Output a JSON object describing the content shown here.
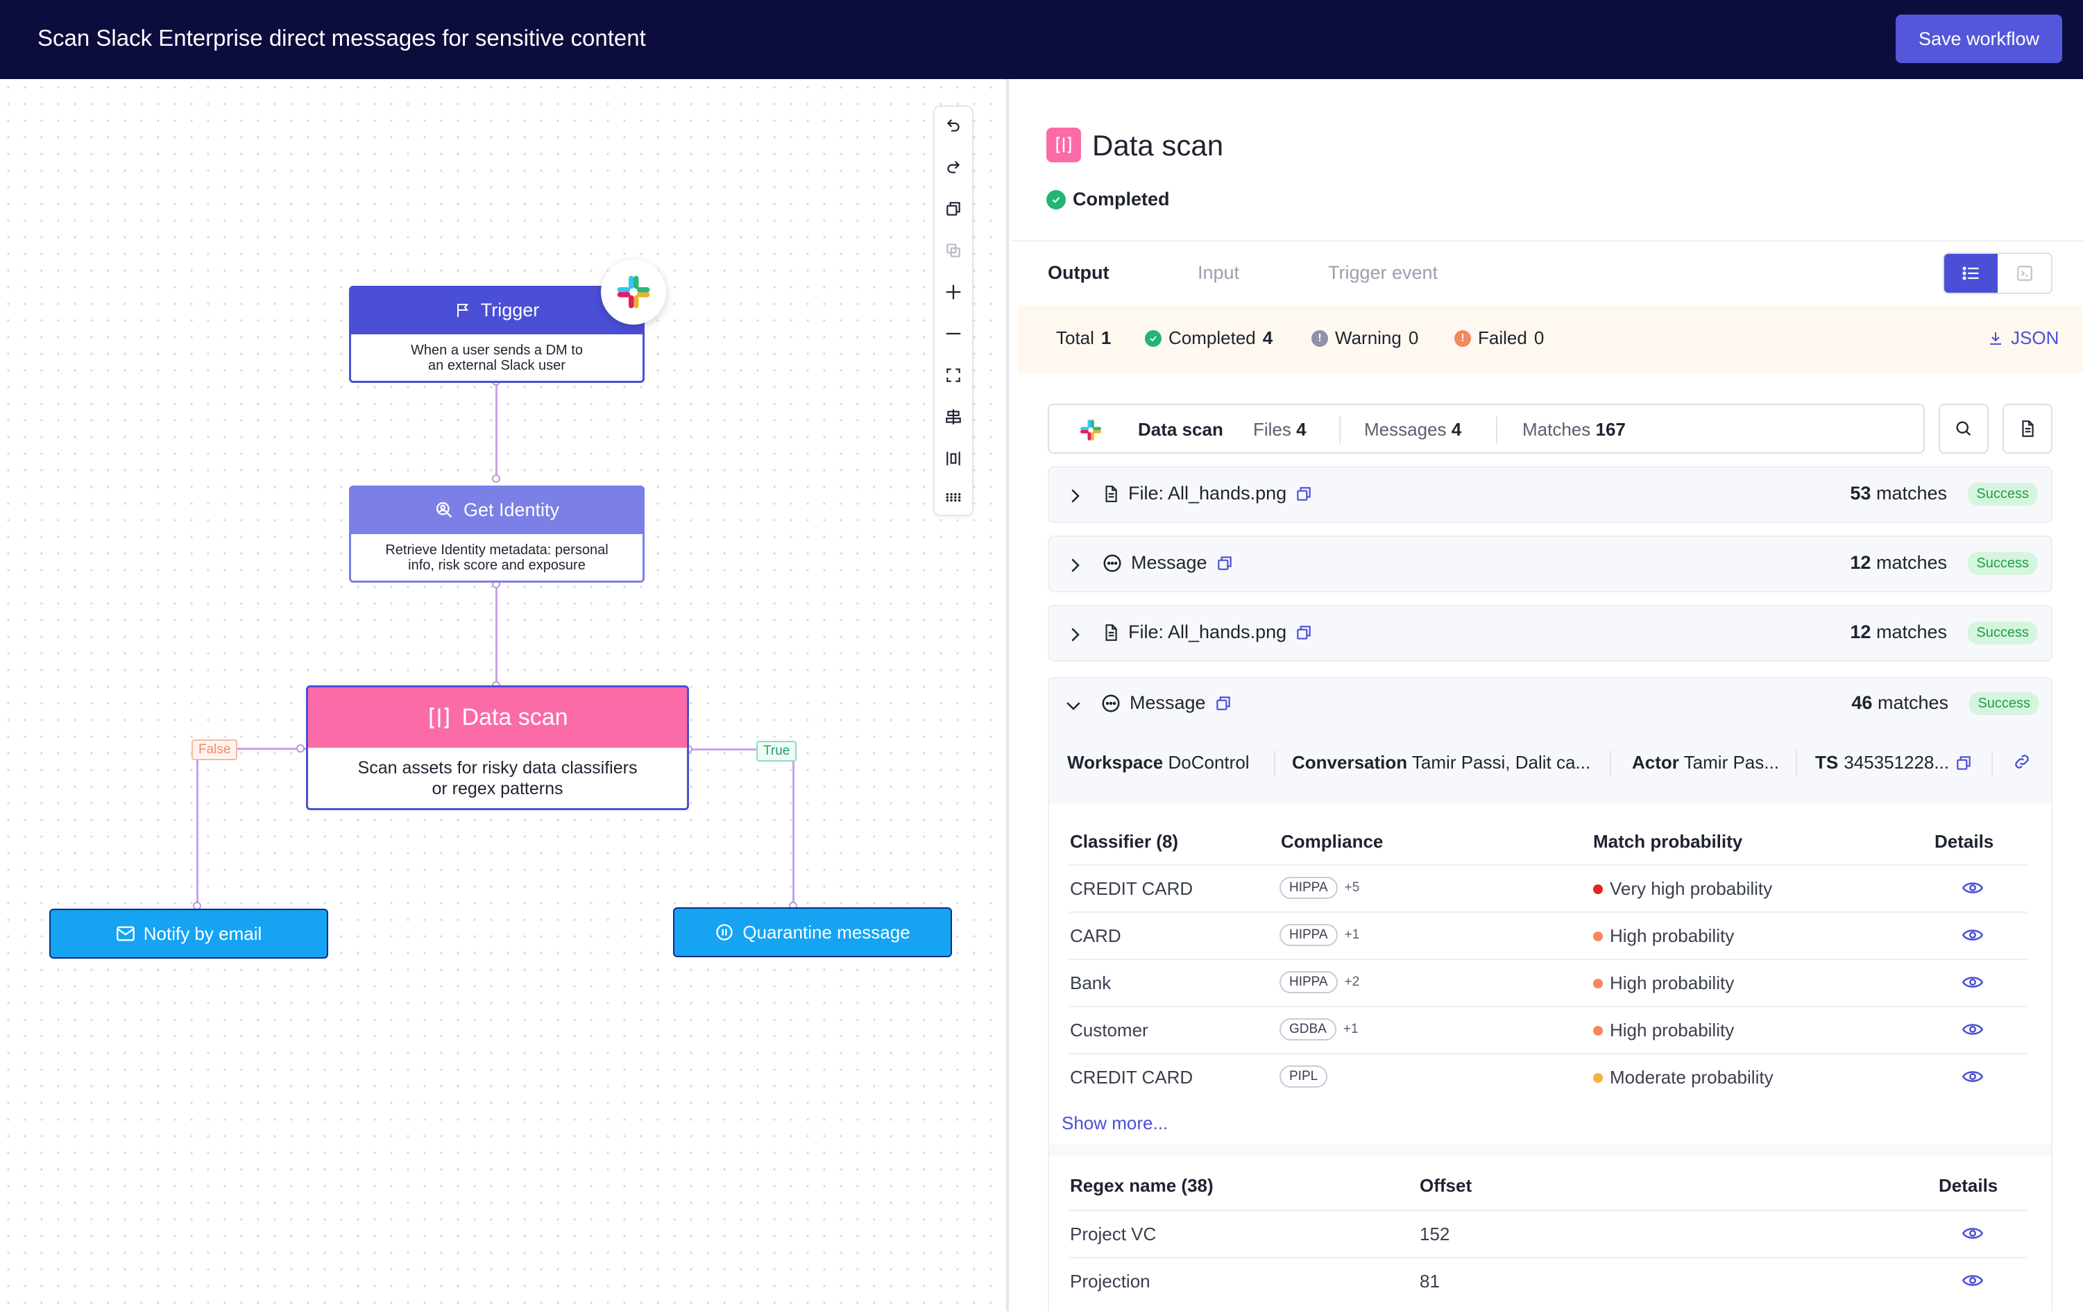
{
  "header": {
    "title": "Scan Slack Enterprise direct messages for sensitive content",
    "save_label": "Save workflow"
  },
  "colors": {
    "accent": "#5457d9",
    "trigger": "#4a4fd6",
    "identity": "#7b7fe6",
    "datascan": "#fb6ba7",
    "action": "#16a3f2"
  },
  "canvas": {
    "toolbar_icons": [
      "undo-icon",
      "redo-icon",
      "copy-icon",
      "duplicate-icon",
      "zoom-in-icon",
      "zoom-out-icon",
      "fit-view-icon",
      "align-icon",
      "distribute-icon",
      "grid-icon"
    ],
    "trigger": {
      "title": "Trigger",
      "line1": "When a user sends a DM to",
      "line2": "an external Slack user"
    },
    "identity": {
      "title": "Get Identity",
      "line1": "Retrieve Identity metadata: personal",
      "line2": "info, risk score and exposure"
    },
    "datascan": {
      "title": "Data scan",
      "line1": "Scan assets for risky data classifiers",
      "line2": "or regex patterns"
    },
    "branch_false": "False",
    "branch_true": "True",
    "notify": "Notify by email",
    "quarantine": "Quarantine message"
  },
  "panel": {
    "title": "Data scan",
    "status": "Completed",
    "tabs": [
      "Output",
      "Input",
      "Trigger event"
    ],
    "summary": {
      "total_label": "Total",
      "total": "1",
      "completed_label": "Completed",
      "completed": "4",
      "warning_label": "Warning",
      "warning": "0",
      "failed_label": "Failed",
      "failed": "0",
      "json_label": "JSON"
    },
    "filter": {
      "name": "Data scan",
      "files_label": "Files",
      "files": "4",
      "messages_label": "Messages",
      "messages": "4",
      "matches_label": "Matches",
      "matches": "167"
    },
    "results": [
      {
        "label": "File: All_hands.png",
        "count": "53",
        "unit": "matches",
        "status": "Success"
      },
      {
        "label": "Message",
        "count": "12",
        "unit": "matches",
        "status": "Success"
      },
      {
        "label": "File: All_hands.png",
        "count": "12",
        "unit": "matches",
        "status": "Success"
      },
      {
        "label": "Message",
        "count": "46",
        "unit": "matches",
        "status": "Success"
      }
    ],
    "meta": {
      "workspace_label": "Workspace",
      "workspace": "DoControl",
      "conversation_label": "Conversation",
      "conversation": "Tamir Passi, Dalit ca...",
      "actor_label": "Actor",
      "actor": "Tamir Pas...",
      "ts_label": "TS",
      "ts": "345351228..."
    },
    "classifier_table": {
      "headers": [
        "Classifier (8)",
        "Compliance",
        "Match probability",
        "Details"
      ],
      "rows": [
        {
          "name": "CREDIT CARD",
          "compliance": "HIPPA",
          "extra": "+5",
          "probability": "Very high probability",
          "color": "#e0281f"
        },
        {
          "name": "CARD",
          "compliance": "HIPPA",
          "extra": "+1",
          "probability": "High probability",
          "color": "#f5875b"
        },
        {
          "name": "Bank",
          "compliance": "HIPPA",
          "extra": "+2",
          "probability": "High probability",
          "color": "#f5875b"
        },
        {
          "name": "Customer",
          "compliance": "GDBA",
          "extra": "+1",
          "probability": "High probability",
          "color": "#f5875b"
        },
        {
          "name": "CREDIT CARD",
          "compliance": "PIPL",
          "extra": "",
          "probability": "Moderate probability",
          "color": "#f7b13c"
        }
      ],
      "show_more": "Show more..."
    },
    "regex_table": {
      "headers": [
        "Regex name (38)",
        "Offset",
        "Details"
      ],
      "rows": [
        {
          "name": "Project VC",
          "offset": "152"
        },
        {
          "name": "Projection",
          "offset": "81"
        }
      ]
    }
  }
}
